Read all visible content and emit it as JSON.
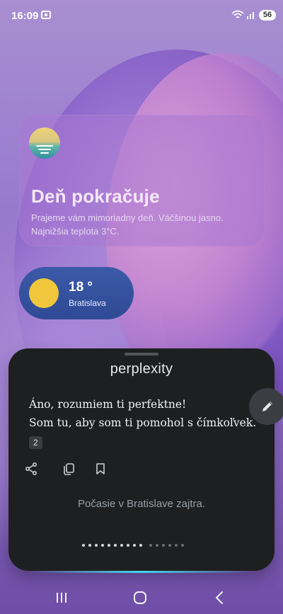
{
  "status_bar": {
    "time": "16:09",
    "battery": "56",
    "icons": [
      "screenshot-icon",
      "wifi-icon",
      "signal-icon",
      "battery-icon"
    ]
  },
  "weather_card": {
    "title": "Deň pokračuje",
    "description": "Prajeme vám mimoriadny deň. Väčšinou jasno. Najnižšia teplota 3°C.",
    "icon": "sunset-icon"
  },
  "weather_pill": {
    "temperature": "18 °",
    "city": "Bratislava",
    "icon": "sun-icon"
  },
  "assistant": {
    "brand": "perplexity",
    "answer_line1": "Áno, rozumiem ti perfektne!",
    "answer_line2": "Som tu, aby som ti pomohol s čímkoľvek.",
    "source_badge": "2",
    "actions": [
      "share-icon",
      "copy-icon",
      "bookmark-icon"
    ],
    "suggestion": "Počasie v Bratislave zajtra.",
    "pagination": {
      "total": 16,
      "active_count": 10
    },
    "accent_color": "#44d8e8"
  },
  "navbar": {
    "buttons": [
      "recent-apps-icon",
      "home-icon",
      "back-icon"
    ]
  }
}
